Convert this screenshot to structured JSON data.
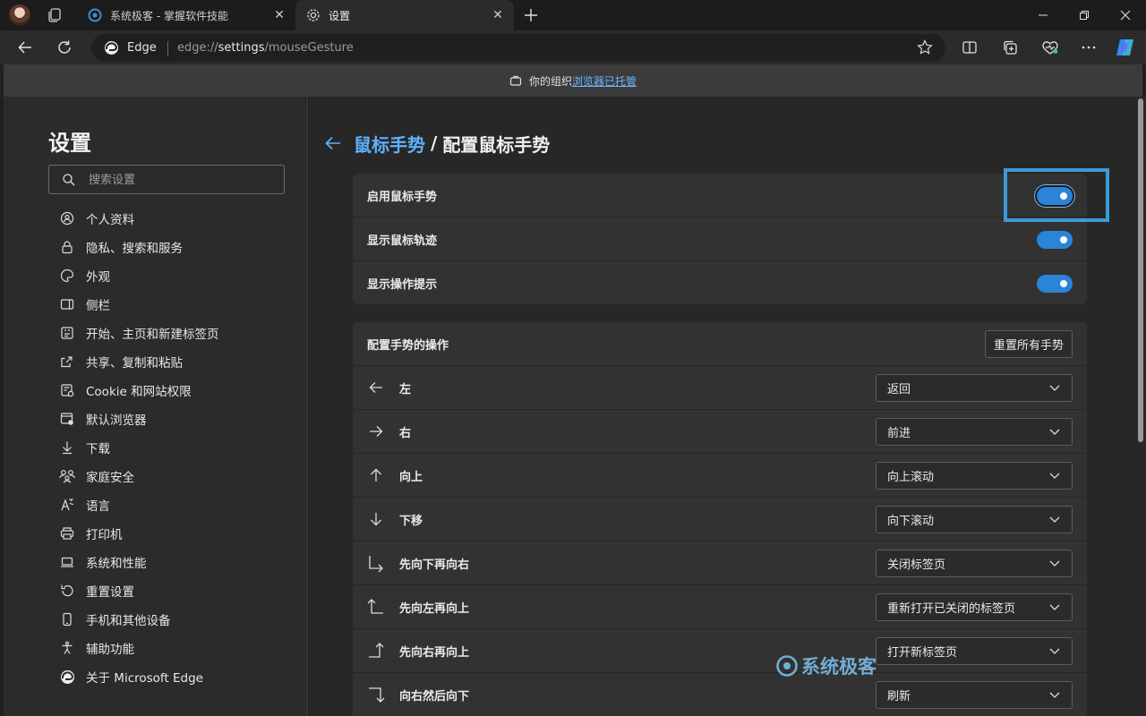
{
  "browser": {
    "tabs": [
      {
        "title": "系统极客 - 掌握软件技能",
        "active": false
      },
      {
        "title": "设置",
        "active": true
      }
    ],
    "address": {
      "site_name": "Edge",
      "url_prefix": "edge://",
      "url_main": "settings",
      "url_suffix": "/mouseGesture"
    }
  },
  "banner": {
    "text": "你的组织",
    "link": "浏览器已托管"
  },
  "sidebar": {
    "title": "设置",
    "search_placeholder": "搜索设置",
    "items": [
      {
        "label": "个人资料",
        "icon": "profile-icon"
      },
      {
        "label": "隐私、搜索和服务",
        "icon": "lock-icon"
      },
      {
        "label": "外观",
        "icon": "palette-icon"
      },
      {
        "label": "侧栏",
        "icon": "sidebar-icon"
      },
      {
        "label": "开始、主页和新建标签页",
        "icon": "home-icon"
      },
      {
        "label": "共享、复制和粘贴",
        "icon": "share-icon"
      },
      {
        "label": "Cookie 和网站权限",
        "icon": "cookie-icon"
      },
      {
        "label": "默认浏览器",
        "icon": "browser-icon"
      },
      {
        "label": "下载",
        "icon": "download-icon"
      },
      {
        "label": "家庭安全",
        "icon": "family-icon"
      },
      {
        "label": "语言",
        "icon": "language-icon"
      },
      {
        "label": "打印机",
        "icon": "printer-icon"
      },
      {
        "label": "系统和性能",
        "icon": "laptop-icon"
      },
      {
        "label": "重置设置",
        "icon": "reset-icon"
      },
      {
        "label": "手机和其他设备",
        "icon": "phone-icon"
      },
      {
        "label": "辅助功能",
        "icon": "accessibility-icon"
      },
      {
        "label": "关于 Microsoft Edge",
        "icon": "edge-icon"
      }
    ]
  },
  "main": {
    "breadcrumb_link": "鼠标手势",
    "breadcrumb_sep": "/",
    "breadcrumb_current": "配置鼠标手势",
    "toggles": [
      {
        "label": "启用鼠标手势",
        "on": true
      },
      {
        "label": "显示鼠标轨迹",
        "on": true
      },
      {
        "label": "显示操作提示",
        "on": true
      }
    ],
    "gestures_header": "配置手势的操作",
    "reset_label": "重置所有手势",
    "gestures": [
      {
        "label": "左",
        "action": "返回",
        "icon": "arrow-left-icon"
      },
      {
        "label": "右",
        "action": "前进",
        "icon": "arrow-right-icon"
      },
      {
        "label": "向上",
        "action": "向上滚动",
        "icon": "arrow-up-icon"
      },
      {
        "label": "下移",
        "action": "向下滚动",
        "icon": "arrow-down-icon"
      },
      {
        "label": "先向下再向右",
        "action": "关闭标签页",
        "icon": "down-right-icon"
      },
      {
        "label": "先向左再向上",
        "action": "重新打开已关闭的标签页",
        "icon": "left-up-icon"
      },
      {
        "label": "先向右再向上",
        "action": "打开新标签页",
        "icon": "right-up-icon"
      },
      {
        "label": "向右然后向下",
        "action": "刷新",
        "icon": "right-down-icon"
      }
    ]
  },
  "watermark": {
    "text": "系统极客"
  },
  "colors": {
    "accent": "#2a84d8",
    "link": "#5fb2ff",
    "highlight": "#3d9ad9"
  }
}
